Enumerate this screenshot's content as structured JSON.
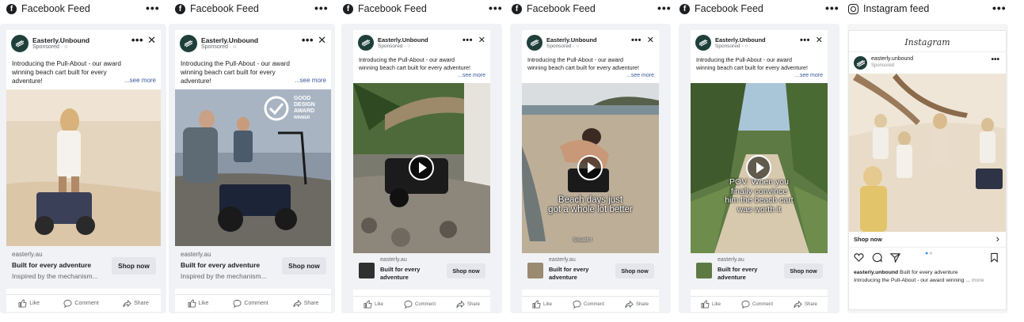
{
  "columns": [
    {
      "platform": "Facebook Feed",
      "icon": "facebook-icon",
      "media_icon": "image",
      "has_play": false
    },
    {
      "platform": "Facebook Feed",
      "icon": "facebook-icon",
      "media_icon": "image",
      "has_play": false
    },
    {
      "platform": "Facebook Feed",
      "icon": "facebook-icon",
      "media_icon": "video",
      "has_play": true
    },
    {
      "platform": "Facebook Feed",
      "icon": "facebook-icon",
      "media_icon": "video",
      "has_play": true
    },
    {
      "platform": "Facebook Feed",
      "icon": "facebook-icon",
      "media_icon": "video",
      "has_play": true
    },
    {
      "platform": "Instagram feed",
      "icon": "instagram-icon",
      "media_icon": "image",
      "has_play": false
    }
  ],
  "head_more": "•••",
  "ad": {
    "account": "Easterly.Unbound",
    "sponsored": "Sponsored · ○",
    "more": "•••",
    "close": "✕",
    "primary_text": "Introducing the Pull-About - our award winning beach cart built for every adventure!",
    "see_more": "...see more",
    "domain": "easterly.au",
    "headline": "Built for every adventure",
    "headline_short": "Built for every adventure",
    "description": "Inspired by the mechanism...",
    "cta": "Shop now",
    "actions": {
      "like": "Like",
      "comment": "Comment",
      "share": "Share"
    }
  },
  "award": {
    "line1": "GOOD",
    "line2": "DESIGN",
    "line3": "AWARD",
    "line4": "WINNER"
  },
  "captions": {
    "col4": [
      "Beach days just",
      "got a whole lot better"
    ],
    "col4_small": "Smooth !",
    "col5": [
      "POV: When you",
      "finally convince",
      "him the beach cart",
      "was worth it"
    ]
  },
  "instagram": {
    "logo": "Instagram",
    "account": "easterly.unbound",
    "sponsored": "Sponsored",
    "cta": "Shop now",
    "caption_account": "easterly.unbound",
    "caption_text": "Built for every adventure",
    "caption_line2": "Introducing the Pull-About - our award winning ...",
    "caption_more": "more"
  },
  "colors": {
    "brand_avatar": "#1f3f3a",
    "link": "#385898",
    "frame_bg": "#f0f2f5",
    "button_bg": "#e4e6eb"
  }
}
